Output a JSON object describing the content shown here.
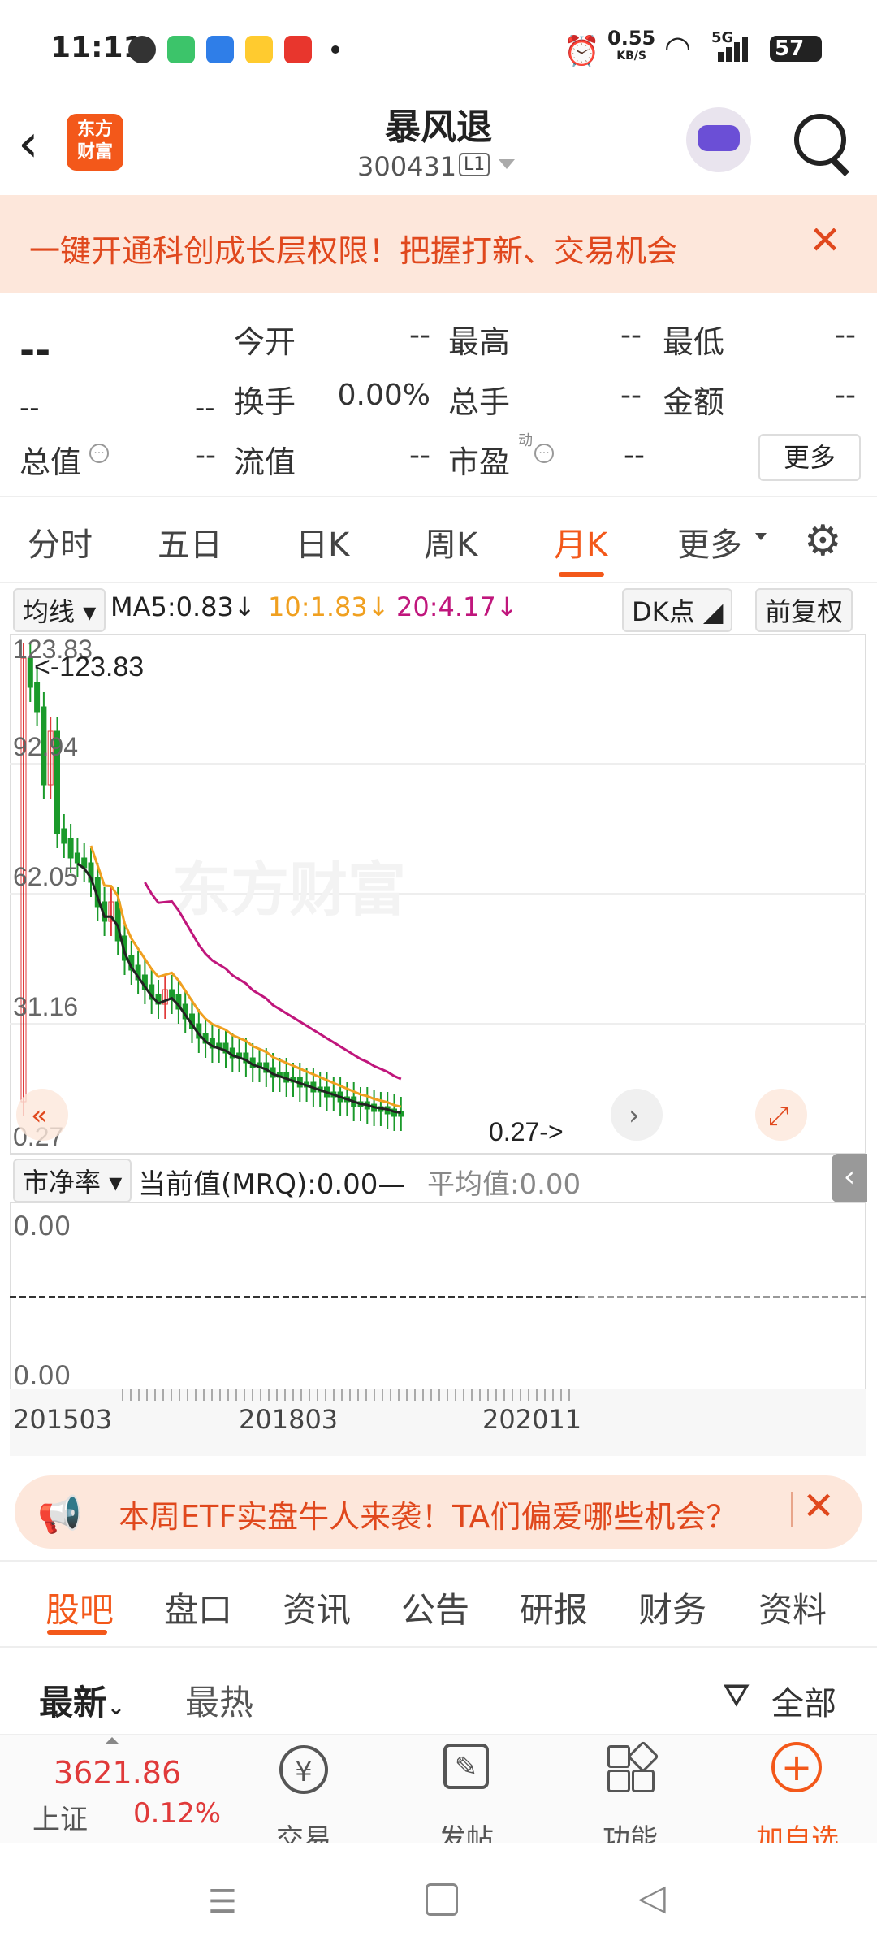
{
  "status": {
    "time": "11:11",
    "net_speed": "0.55",
    "net_unit": "KB/S",
    "signal": "5G",
    "battery": "57"
  },
  "header": {
    "logo_text": "东方\n财富",
    "title": "暴风退",
    "code": "300431",
    "level": "L1"
  },
  "banner": {
    "text": "一键开通科创成长层权限！把握打新、交易机会"
  },
  "quote": {
    "price": "--",
    "change1": "--",
    "change2": "--",
    "rows": [
      [
        {
          "label": "今开",
          "value": "--"
        },
        {
          "label": "最高",
          "value": "--"
        },
        {
          "label": "最低",
          "value": "--"
        }
      ],
      [
        {
          "label": "换手",
          "value": "0.00%"
        },
        {
          "label": "总手",
          "value": "--"
        },
        {
          "label": "金额",
          "value": "--"
        }
      ],
      [
        {
          "label": "总值",
          "value": "--"
        },
        {
          "label": "流值",
          "value": "--"
        },
        {
          "label": "市盈",
          "value": "--",
          "badge": "动"
        }
      ]
    ],
    "more": "更多"
  },
  "periods": [
    "分时",
    "五日",
    "日K",
    "周K",
    "月K",
    "更多"
  ],
  "active_period": "月K",
  "ma_bar": {
    "selector": "均线",
    "ma5": "MA5:0.83",
    "ma10": "10:1.83",
    "ma20": "20:4.17",
    "dk": "DK点",
    "fq": "前复权"
  },
  "chart_data": {
    "type": "candlestick",
    "y_ticks": [
      "123.83",
      "92.94",
      "62.05",
      "31.16",
      "0.27"
    ],
    "max_label": "<-123.83",
    "min_label": "0.27->",
    "watermark": "东方财富",
    "x_ticks": [
      "201503",
      "201803",
      "202011"
    ],
    "colors": {
      "up": "#e03a3a",
      "down": "#1a9a2a",
      "ma5": "#222222",
      "ma10": "#f0a020",
      "ma20": "#c0167c"
    }
  },
  "indicator": {
    "selector": "市净率",
    "current": "当前值(MRQ):0.00",
    "avg": "平均值:0.00",
    "top": "0.00",
    "bottom": "0.00"
  },
  "promo": {
    "text": "本周ETF实盘牛人来袭！TA们偏爱哪些机会？"
  },
  "subtabs": [
    "股吧",
    "盘口",
    "资讯",
    "公告",
    "研报",
    "财务",
    "资料"
  ],
  "sort": {
    "latest": "最新",
    "hot": "最热",
    "filter": "全部"
  },
  "bottom_nav": {
    "index_value": "3621.86",
    "index_name": "上证",
    "index_change": "0.12%",
    "items": [
      "交易",
      "发帖",
      "功能",
      "加自选"
    ]
  }
}
